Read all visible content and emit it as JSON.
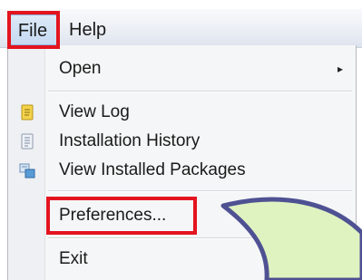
{
  "menubar": {
    "file_label": "File",
    "help_label": "Help"
  },
  "file_menu": {
    "open": "Open",
    "open_submenu_arrow": "▸",
    "view_log": "View Log",
    "installation_history": "Installation History",
    "view_installed_packages": "View Installed Packages",
    "preferences": "Preferences...",
    "exit": "Exit"
  },
  "icons": {
    "view_log": "log-file-icon",
    "installation_history": "history-document-icon",
    "view_installed_packages": "packages-icon"
  },
  "annotation_colors": {
    "highlight_box": "#e3141f",
    "arrow_fill": "#dff3c0",
    "arrow_outline": "#4e5192"
  }
}
